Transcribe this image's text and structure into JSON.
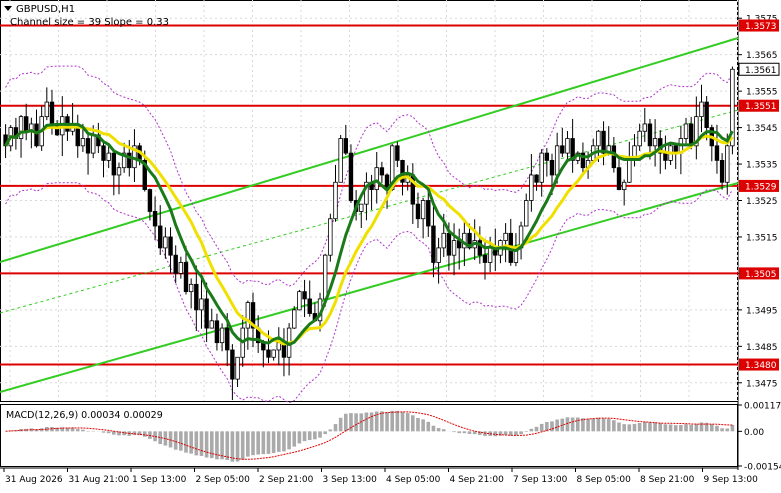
{
  "header": {
    "symbol": "GBPUSD,H1",
    "channel_info": "Channel size = 39 Slope = 0.33",
    "menu_icon": "triangle-down-icon"
  },
  "price_axis": {
    "ticks": [
      "1.3575",
      "1.3565",
      "1.3555",
      "1.3545",
      "1.3535",
      "1.3525",
      "1.3515",
      "1.3505",
      "1.3495",
      "1.3485",
      "1.3475"
    ]
  },
  "level_labels": [
    {
      "name": "level-1-3573",
      "text": "1.3573",
      "price": 1.3573
    },
    {
      "name": "level-1-3551",
      "text": "1.3551",
      "price": 1.3551
    },
    {
      "name": "level-1-3529",
      "text": "1.3529",
      "price": 1.3529
    },
    {
      "name": "level-1-3505",
      "text": "1.3505",
      "price": 1.3505
    },
    {
      "name": "level-1-3480",
      "text": "1.3480",
      "price": 1.348
    }
  ],
  "current_price": {
    "text": "1.3561",
    "price": 1.3561
  },
  "time_axis": {
    "labels": [
      "31 Aug 2026",
      "31 Aug 21:00",
      "1 Sep 13:00",
      "2 Sep 05:00",
      "2 Sep 21:00",
      "3 Sep 13:00",
      "4 Sep 05:00",
      "4 Sep 21:00",
      "7 Sep 13:00",
      "8 Sep 05:00",
      "8 Sep 21:00",
      "9 Sep 13:00"
    ]
  },
  "macd": {
    "title": "MACD(12,26,9) 0.00034 0.00029",
    "ticks": [
      "0.00117",
      "0.00",
      "-0.00154"
    ]
  },
  "colors": {
    "level_line": "#dd0000",
    "ma_fast": "#f0e000",
    "ma_slow": "#1a7a1a",
    "channel": "#33cc22",
    "band": "#b133cc",
    "candle": "#000000",
    "macd_hist": "#aaaaaa",
    "macd_signal": "#dd0000"
  },
  "chart_data": {
    "type": "candlestick",
    "ylim": [
      1.347,
      1.358
    ],
    "levels": [
      1.3573,
      1.3551,
      1.3529,
      1.3505,
      1.348
    ],
    "series": [
      {
        "name": "close",
        "values": [
          1.354,
          1.3545,
          1.3542,
          1.3548,
          1.3544,
          1.3546,
          1.354,
          1.3548,
          1.3552,
          1.3546,
          1.3543,
          1.3548,
          1.3544,
          1.3546,
          1.354,
          1.3542,
          1.3538,
          1.3543,
          1.354,
          1.3536,
          1.3538,
          1.3532,
          1.3534,
          1.3538,
          1.3534,
          1.354,
          1.3536,
          1.3528,
          1.3522,
          1.3518,
          1.3512,
          1.3515,
          1.351,
          1.3505,
          1.3508,
          1.35,
          1.3502,
          1.3495,
          1.3498,
          1.349,
          1.3492,
          1.3486,
          1.349,
          1.3484,
          1.3476,
          1.3482,
          1.349,
          1.3497,
          1.349,
          1.3486,
          1.3484,
          1.3482,
          1.3484,
          1.3486,
          1.3482,
          1.349,
          1.3495,
          1.35,
          1.3498,
          1.3494,
          1.3492,
          1.3498,
          1.351,
          1.352,
          1.353,
          1.3542,
          1.3538,
          1.3525,
          1.3522,
          1.3524,
          1.353,
          1.3528,
          1.3534,
          1.3532,
          1.3528,
          1.354,
          1.3536,
          1.353,
          1.3532,
          1.3524,
          1.352,
          1.3525,
          1.3518,
          1.3508,
          1.3512,
          1.3516,
          1.351,
          1.3514,
          1.3512,
          1.3516,
          1.3512,
          1.3514,
          1.351,
          1.3508,
          1.3512,
          1.351,
          1.3514,
          1.3516,
          1.3508,
          1.3512,
          1.3518,
          1.3525,
          1.3532,
          1.353,
          1.3538,
          1.3536,
          1.3532,
          1.354,
          1.3538,
          1.3542,
          1.3536,
          1.3538,
          1.3534,
          1.3536,
          1.354,
          1.3544,
          1.3538,
          1.354,
          1.3534,
          1.3528,
          1.353,
          1.3536,
          1.354,
          1.3544,
          1.3546,
          1.354,
          1.3542,
          1.3538,
          1.3536,
          1.354,
          1.3538,
          1.3542,
          1.3546,
          1.354,
          1.3548,
          1.3552,
          1.3545,
          1.354,
          1.3536,
          1.353,
          1.354,
          1.3561
        ]
      }
    ],
    "macd_values": {
      "main": 0.00034,
      "signal": 0.00029
    }
  }
}
